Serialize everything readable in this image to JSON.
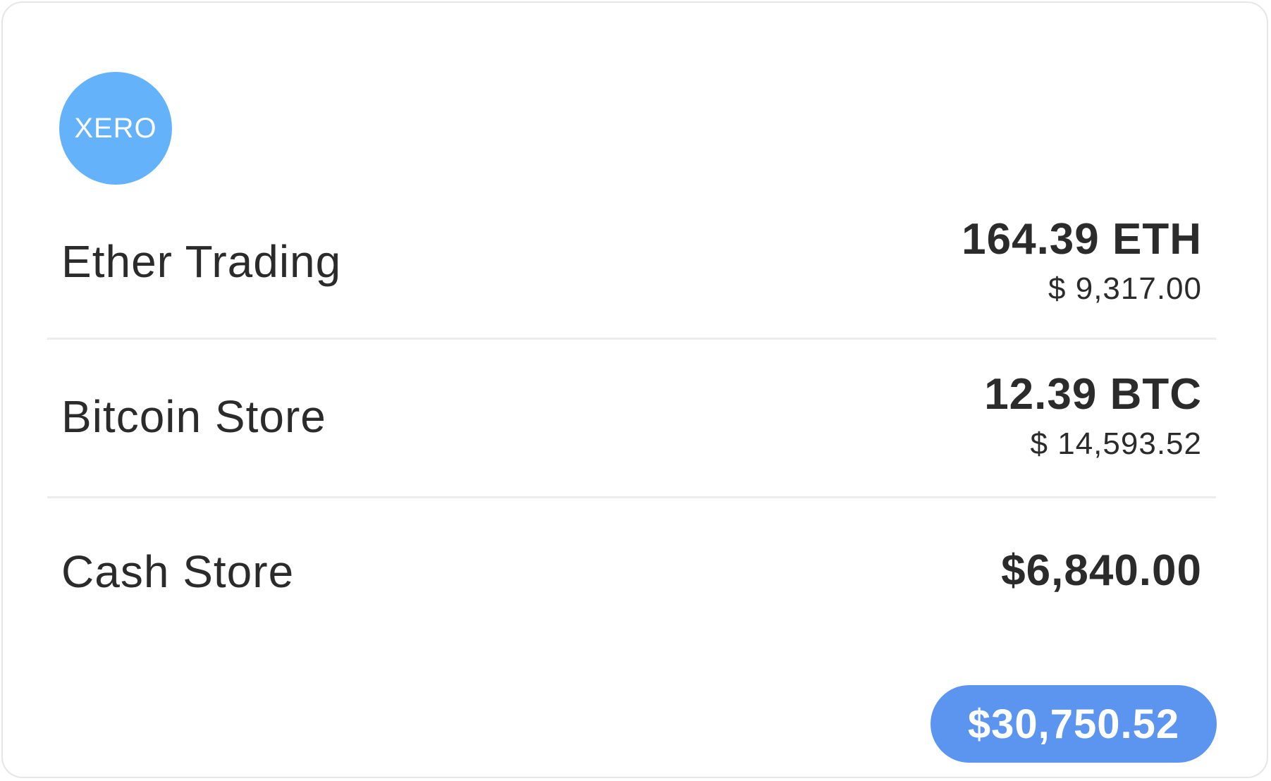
{
  "logo": {
    "text": "XERO",
    "color": "#64b2fa"
  },
  "accounts": [
    {
      "name": "Ether Trading",
      "amount": "164.39 ETH",
      "fiat": "$ 9,317.00"
    },
    {
      "name": "Bitcoin Store",
      "amount": "12.39 BTC",
      "fiat": "$ 14,593.52"
    },
    {
      "name": "Cash Store",
      "amount": "$6,840.00"
    }
  ],
  "total": {
    "value": "$30,750.52",
    "color": "#5b95ef"
  }
}
